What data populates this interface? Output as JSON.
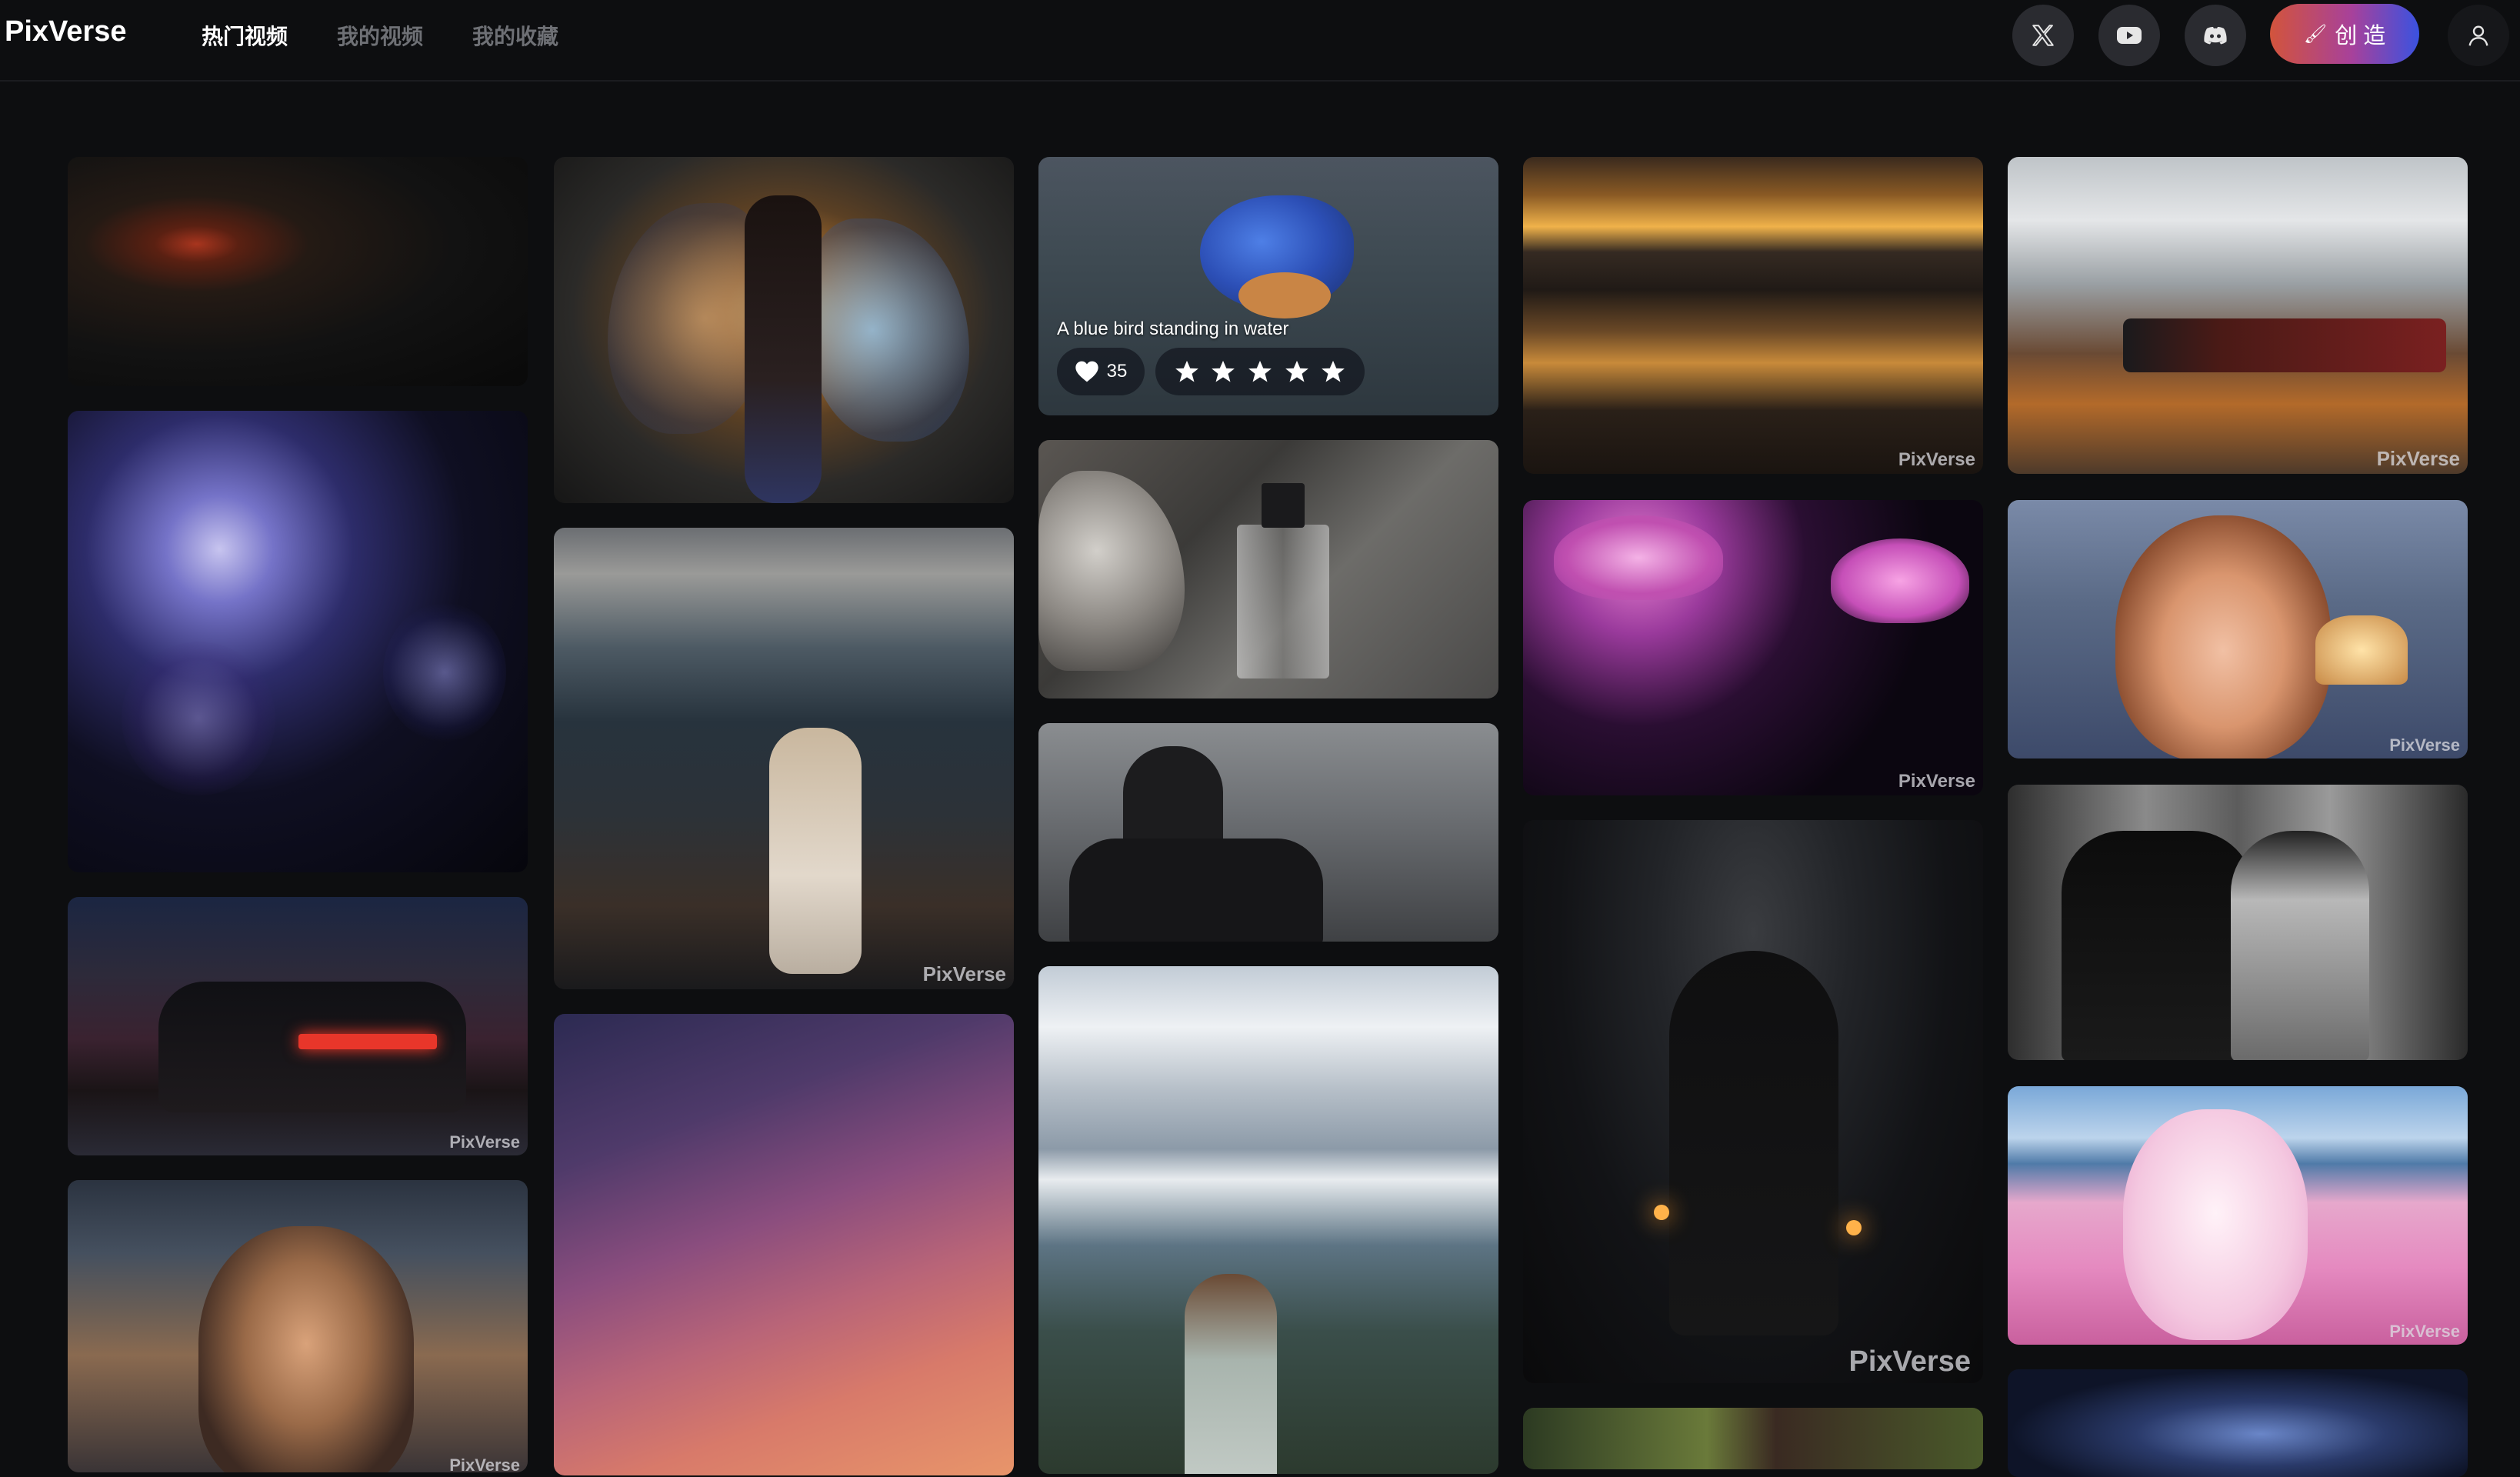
{
  "header": {
    "logo": "PixVerse",
    "tabs": [
      {
        "label": "热门视频",
        "active": true
      },
      {
        "label": "我的视频",
        "active": false
      },
      {
        "label": "我的收藏",
        "active": false
      }
    ],
    "icons": [
      "x-twitter-icon",
      "youtube-icon",
      "discord-icon",
      "user-icon"
    ],
    "create_label": "创 造",
    "create_icon": "brush-icon"
  },
  "watermark": "PixVerse",
  "featured": {
    "caption": "A blue bird standing in water",
    "likes": "35",
    "rating_stars": 5
  },
  "tiles": [
    {
      "subject": "red car driving on night road",
      "col": 1
    },
    {
      "subject": "glowing jellyfish in dark",
      "col": 1
    },
    {
      "subject": "muscle car on rainy neon city street",
      "col": 1,
      "watermark": true
    },
    {
      "subject": "woman with curly hair at sunset beach",
      "col": 1,
      "watermark": true
    },
    {
      "subject": "fairy with butterfly wings in forest",
      "col": 2
    },
    {
      "subject": "woman walking by lake at dusk",
      "col": 2,
      "watermark": true
    },
    {
      "subject": "purple pink sunset clouds",
      "col": 2
    },
    {
      "subject": "blue bird standing in water",
      "col": 3,
      "featured": true
    },
    {
      "subject": "perfume bottle on stone",
      "col": 3
    },
    {
      "subject": "rider on horse in medieval town",
      "col": 3
    },
    {
      "subject": "girl looking at snowy mountains",
      "col": 3
    },
    {
      "subject": "sunset over lake",
      "col": 4,
      "watermark": true
    },
    {
      "subject": "pink jellyfish reflections",
      "col": 4,
      "watermark": true
    },
    {
      "subject": "hooded figure in dark forest",
      "col": 4,
      "watermark": true
    },
    {
      "subject": "forest with person",
      "col": 4
    },
    {
      "subject": "steam train through village",
      "col": 5,
      "watermark": true
    },
    {
      "subject": "animated girl in bedroom",
      "col": 5,
      "watermark": true
    },
    {
      "subject": "black and white couple in rain",
      "col": 5
    },
    {
      "subject": "pink dog with glasses on beach",
      "col": 5,
      "watermark": true
    },
    {
      "subject": "dark night scene",
      "col": 5
    }
  ],
  "colors": {
    "background": "#0d0e10",
    "create_gradient_start": "#d2543c",
    "create_gradient_end": "#3a52e0",
    "icon_button_bg": "#2a2b30"
  }
}
